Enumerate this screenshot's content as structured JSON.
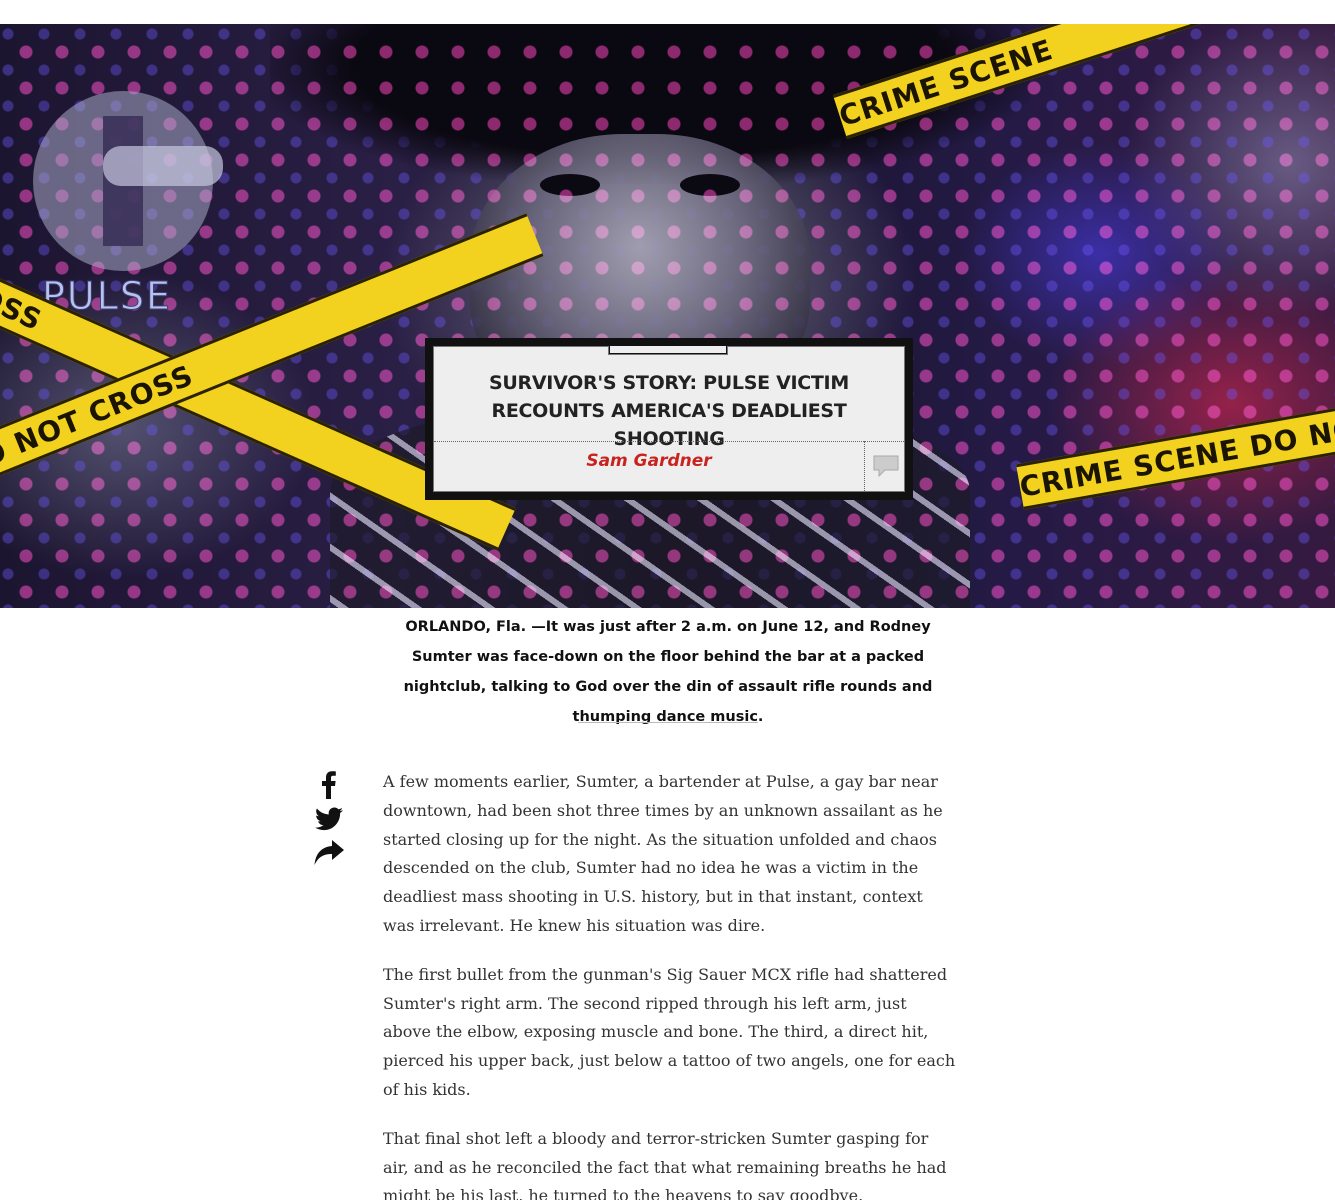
{
  "hero": {
    "logo_text": "PULSE",
    "tape_texts": [
      "CROSS",
      "DO NOT CROSS",
      "CRIME SCENE",
      "CRIME SCENE DO NOT CR"
    ]
  },
  "headline": {
    "title": "SURVIVOR'S STORY: PULSE VICTIM RECOUNTS AMERICA'S DEADLIEST SHOOTING",
    "author": "Sam Gardner"
  },
  "lede": "ORLANDO, Fla. —It was just after 2 a.m. on June 12, and Rodney Sumter was face-down on the floor behind the bar at a packed nightclub, talking to God over the din of assault rifle rounds and thumping dance music.",
  "share": {
    "icons": [
      "facebook-icon",
      "twitter-icon",
      "share-icon"
    ]
  },
  "body": {
    "paragraphs": [
      "A few moments earlier, Sumter, a bartender at Pulse, a gay bar near downtown, had been shot three times by an unknown assailant as he started closing up for the night. As the situation unfolded and chaos descended on the club, Sumter had no idea he was a victim in the deadliest mass shooting in U.S. history, but in that instant, context was irrelevant. He knew his situation was dire.",
      "The first bullet from the gunman's Sig Sauer MCX rifle had shattered Sumter's right arm. The second ripped through his left arm, just above the elbow, exposing muscle and bone. The third, a direct hit, pierced his upper back, just below a tattoo of two angels, one for each of his kids.",
      "That final shot left a bloody and terror-stricken Sumter gasping for air, and as he reconciled the fact that what remaining breaths he had might be his last, he turned to the heavens to say goodbye."
    ]
  },
  "colors": {
    "byline": "#c8231f",
    "tape": "#f2d21e",
    "card_bg": "#eeeeee"
  }
}
